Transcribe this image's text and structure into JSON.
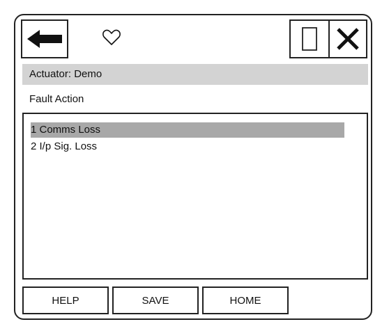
{
  "header": {
    "back_icon": "back-arrow-icon",
    "favorite_icon": "heart-outline-icon",
    "window_icon": "window-rectangle-icon",
    "close_icon": "close-x-icon"
  },
  "title_bar": {
    "text": "Actuator: Demo"
  },
  "subtitle": {
    "text": "Fault Action"
  },
  "list": {
    "items": [
      {
        "label": "1 Comms Loss",
        "selected": true
      },
      {
        "label": "2 I/p Sig. Loss",
        "selected": false
      }
    ]
  },
  "buttons": {
    "help": "HELP",
    "save": "SAVE",
    "home": "HOME"
  },
  "colors": {
    "title_bar_bg": "#d3d3d3",
    "selected_item_bg": "#a8a8a8",
    "border": "#222222"
  }
}
